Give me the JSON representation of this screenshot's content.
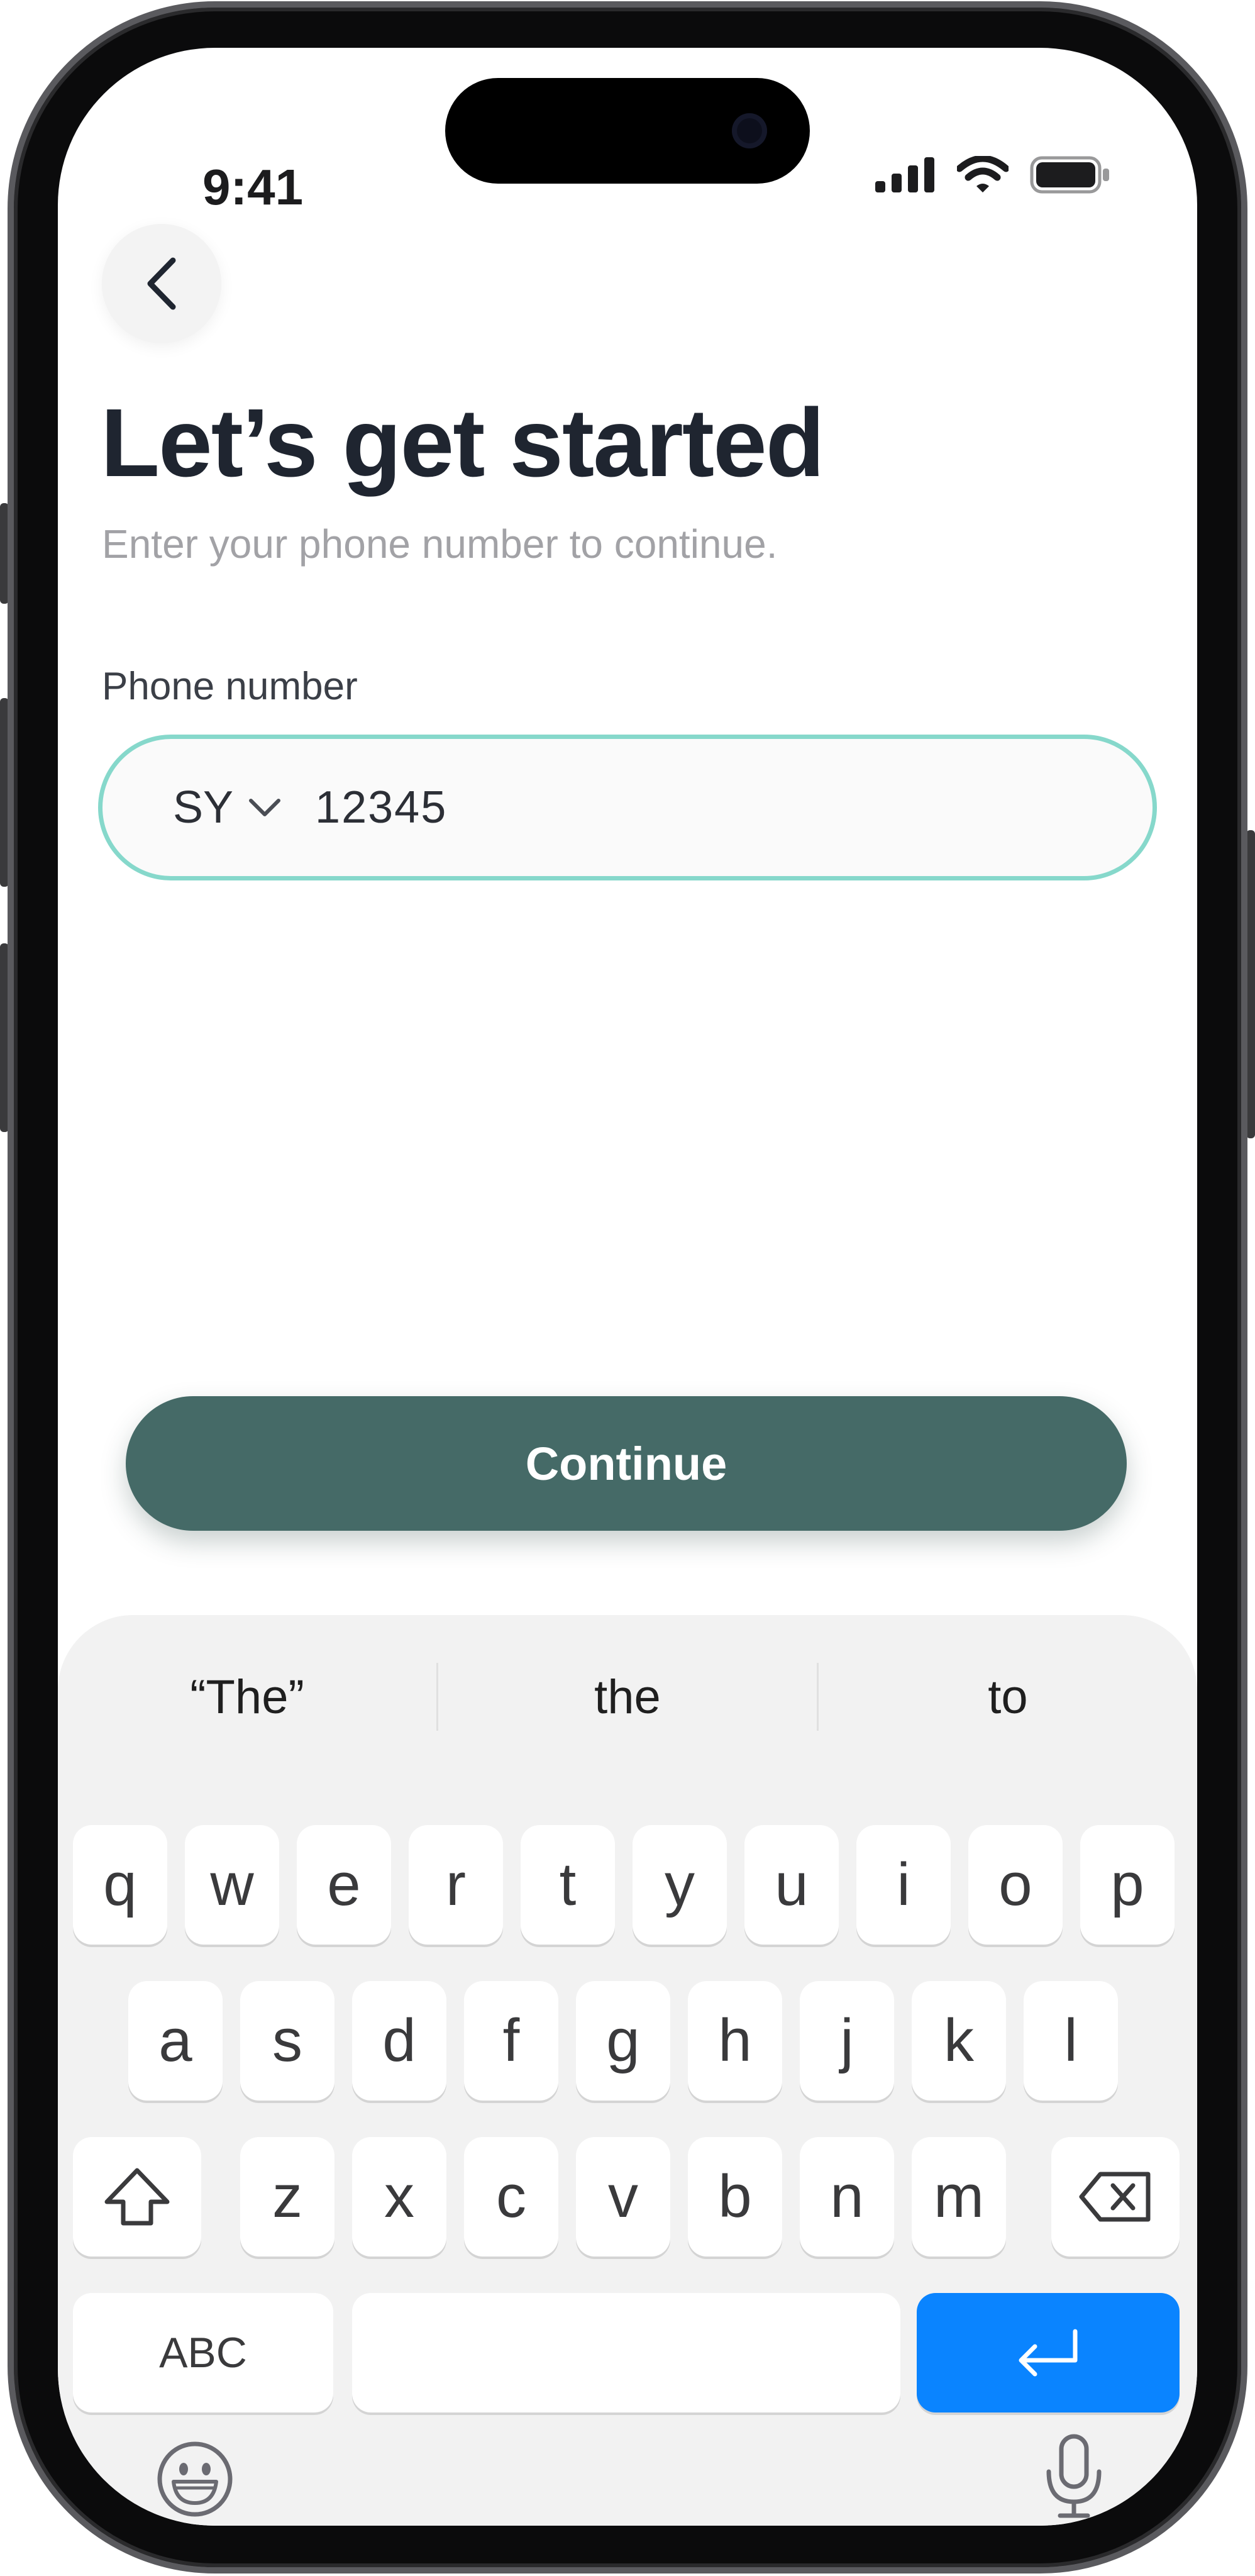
{
  "status_bar": {
    "time": "9:41"
  },
  "header": {
    "back_icon": "chevron-left-icon",
    "title": "Let’s get started",
    "subtitle": "Enter your phone number to continue."
  },
  "phone": {
    "label": "Phone number",
    "country_code": "SY",
    "value": "12345"
  },
  "actions": {
    "continue_label": "Continue",
    "button_color": "#456a67"
  },
  "keyboard": {
    "suggestions": [
      "“The”",
      "the",
      "to"
    ],
    "row1": [
      "q",
      "w",
      "e",
      "r",
      "t",
      "y",
      "u",
      "i",
      "o",
      "p"
    ],
    "row2": [
      "a",
      "s",
      "d",
      "f",
      "g",
      "h",
      "j",
      "k",
      "l"
    ],
    "row3": [
      "z",
      "x",
      "c",
      "v",
      "b",
      "n",
      "m"
    ],
    "abc_label": "ABC",
    "return_color": "#0a84ff",
    "icons": [
      "shift-icon",
      "backspace-icon",
      "return-icon",
      "emoji-icon",
      "microphone-icon"
    ]
  },
  "colors": {
    "field_border": "#86d8cb",
    "title": "#1f2530"
  }
}
